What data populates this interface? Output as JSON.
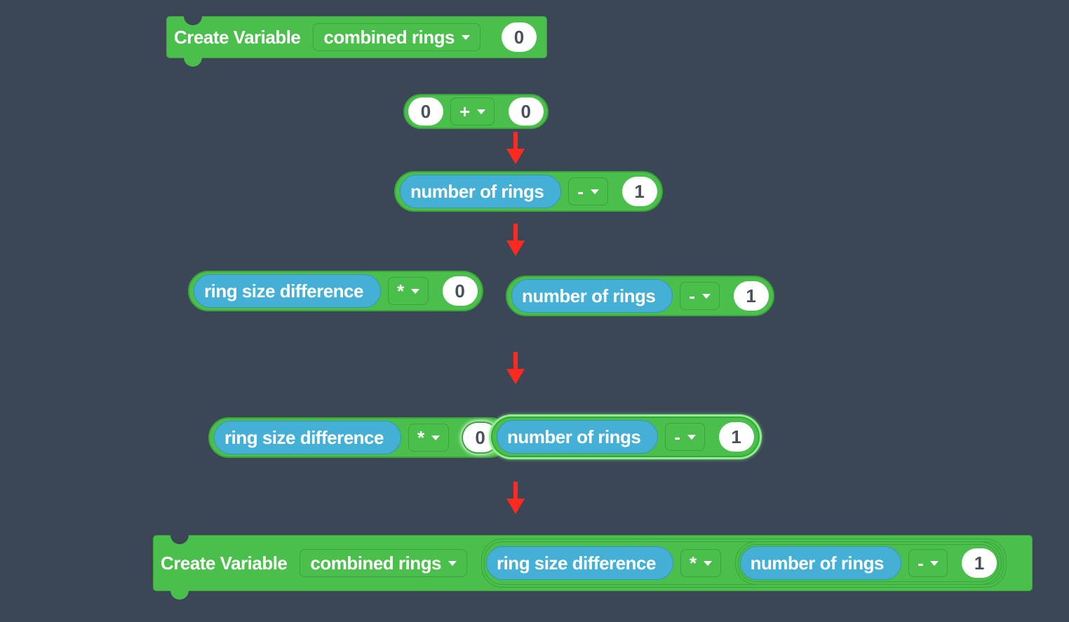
{
  "colors": {
    "background": "#3b4656",
    "block_green": "#4bbf4b",
    "variable_blue": "#45b0d6",
    "arrow_red": "#ff2a1f"
  },
  "steps": [
    {
      "type": "create-variable",
      "title": "Create Variable",
      "variable": "combined rings",
      "value": "0"
    },
    {
      "type": "math-expression",
      "left": "0",
      "operator": "+",
      "right": "0"
    },
    {
      "type": "math-expression",
      "left_variable": "number of rings",
      "operator": "-",
      "right": "1"
    },
    {
      "type": "two-expressions",
      "first": {
        "left_variable": "ring size difference",
        "operator": "*",
        "right": "0"
      },
      "second": {
        "left_variable": "number of rings",
        "operator": "-",
        "right": "1"
      }
    },
    {
      "type": "dragging-into-slot",
      "outer": {
        "left_variable": "ring size difference",
        "operator": "*",
        "right": "0"
      },
      "inner": {
        "left_variable": "number of rings",
        "operator": "-",
        "right": "1"
      }
    },
    {
      "type": "create-variable-final",
      "title": "Create Variable",
      "variable": "combined rings",
      "outer": {
        "left_variable": "ring size difference",
        "operator": "*"
      },
      "inner": {
        "left_variable": "number of rings",
        "operator": "-",
        "right": "1"
      }
    }
  ],
  "arrows": [
    "arrow-1",
    "arrow-2",
    "arrow-3",
    "arrow-4"
  ]
}
